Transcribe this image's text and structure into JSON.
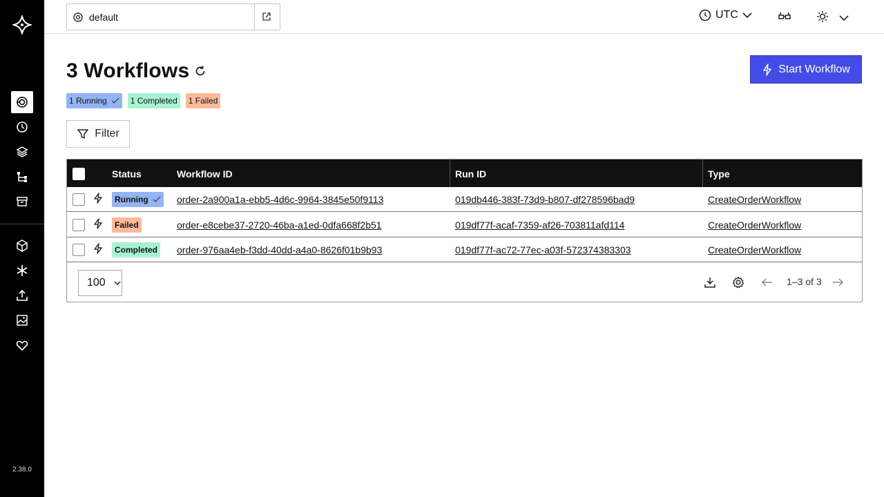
{
  "app": {
    "version": "2.38.0"
  },
  "topbar": {
    "namespace": "default",
    "timezone": "UTC"
  },
  "page": {
    "title": "3 Workflows",
    "start_button": "Start Workflow",
    "filter_button": "Filter"
  },
  "summary_badges": [
    {
      "label": "1 Running",
      "color": "#93b4f5"
    },
    {
      "label": "1 Completed",
      "color": "#a7f3d0"
    },
    {
      "label": "1 Failed",
      "color": "#fdba9a"
    }
  ],
  "table": {
    "headers": {
      "status": "Status",
      "workflow_id": "Workflow ID",
      "run_id": "Run ID",
      "type": "Type"
    },
    "rows": [
      {
        "status": "Running",
        "status_color": "#93b4f5",
        "workflow_id": "order-2a900a1a-ebb5-4d6c-9964-3845e50f9113",
        "run_id": "019db446-383f-73d9-b807-df278596bad9",
        "type": "CreateOrderWorkflow"
      },
      {
        "status": "Failed",
        "status_color": "#fdba9a",
        "workflow_id": "order-e8cebe37-2720-46ba-a1ed-0dfa668f2b51",
        "run_id": "019df77f-acaf-7359-af26-703811afd114",
        "type": "CreateOrderWorkflow"
      },
      {
        "status": "Completed",
        "status_color": "#a7f3d0",
        "workflow_id": "order-976aa4eb-f3dd-40dd-a4a0-8626f01b9b93",
        "run_id": "019df77f-ac72-77ec-a03f-572374383303",
        "type": "CreateOrderWorkflow"
      }
    ]
  },
  "footer": {
    "per_page": "100",
    "pagination": "1–3 of 3"
  }
}
